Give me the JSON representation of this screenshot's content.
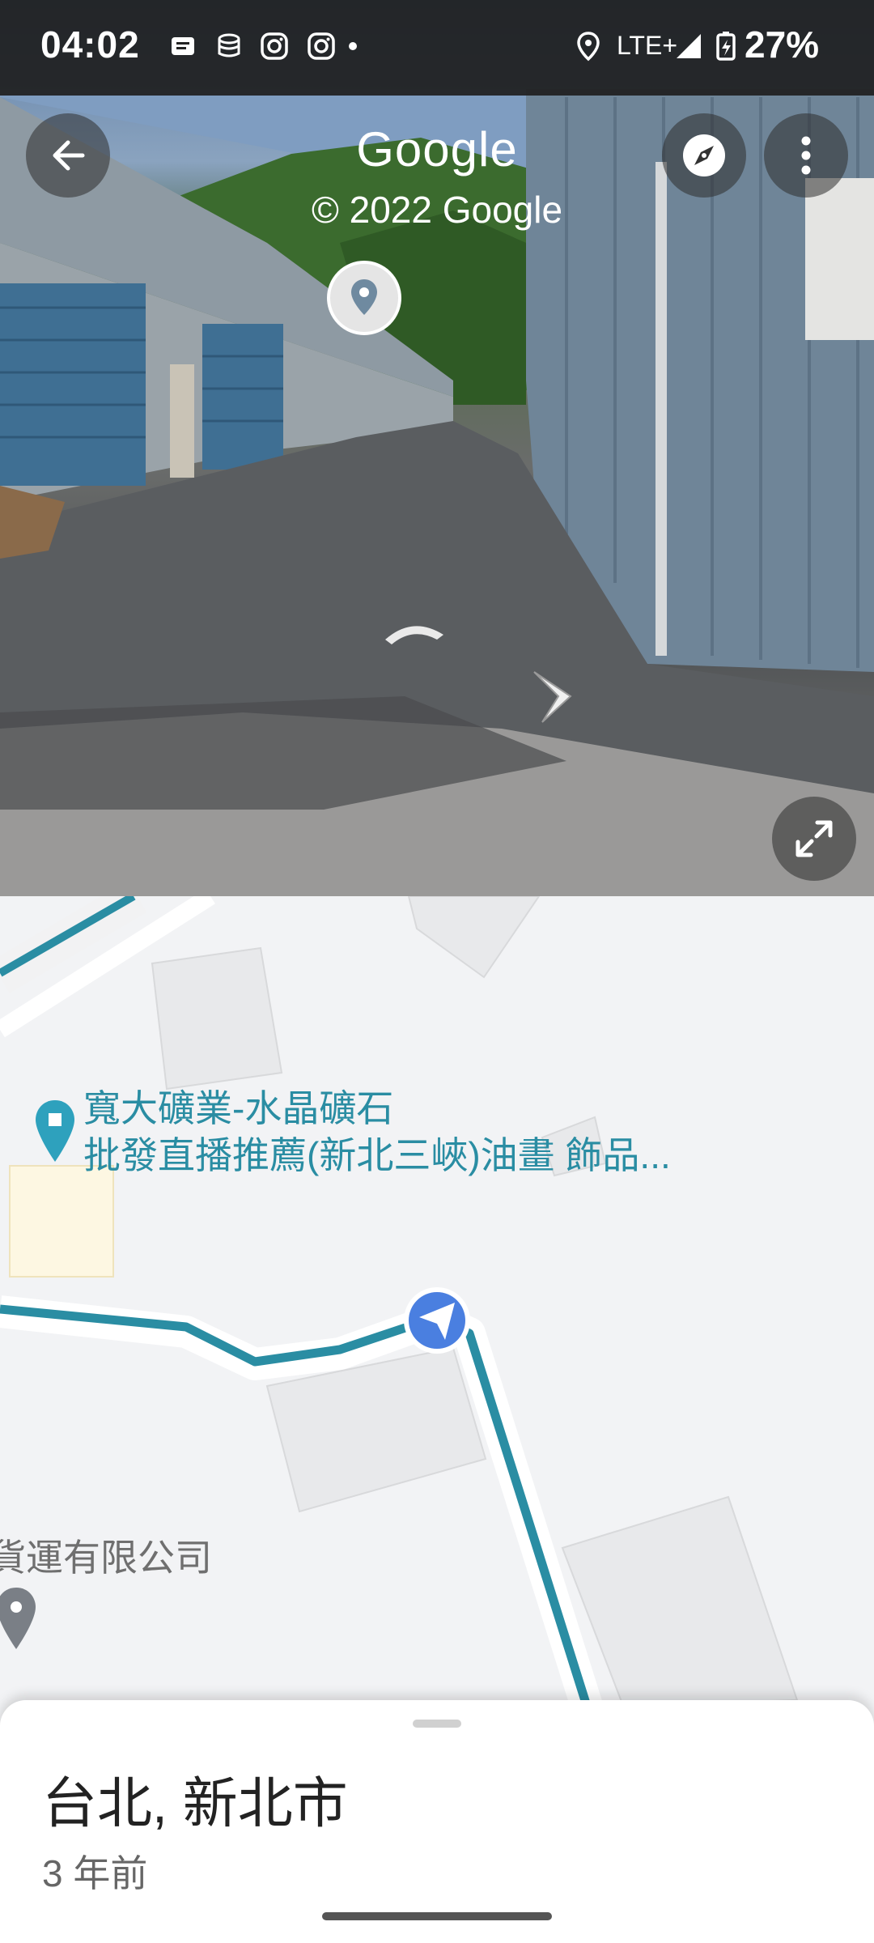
{
  "status_bar": {
    "time": "04:02",
    "network": "LTE+",
    "battery": "27%",
    "icons": [
      "notification-icon",
      "database-icon",
      "instagram-icon",
      "instagram-icon",
      "dot-icon",
      "location-icon",
      "signal-icon",
      "battery-icon"
    ]
  },
  "street_view": {
    "brand": "Google",
    "copyright": "© 2022 Google",
    "buttons": {
      "back": "back-arrow-icon",
      "compass": "compass-icon",
      "menu": "more-vert-icon",
      "fullscreen": "expand-icon"
    }
  },
  "map": {
    "poi_1_line_1": "寬大礦業-水晶礦石",
    "poi_1_line_2": "批發直播推薦(新北三峽)油畫 飾品...",
    "poi_2": "貨運有限公司",
    "route_color": "#2a8da3",
    "location_color": "#4a7fe0"
  },
  "sheet": {
    "title": "台北, 新北市",
    "subtitle": "3 年前"
  }
}
